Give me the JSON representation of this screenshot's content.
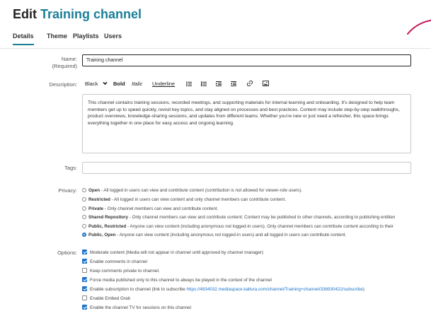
{
  "header": {
    "title_prefix": "Edit ",
    "title_name": "Training channel"
  },
  "tabs": [
    {
      "label": "Details",
      "active": true
    },
    {
      "label": "Theme",
      "active": false
    },
    {
      "label": "Playlists",
      "active": false
    },
    {
      "label": "Users",
      "active": false
    }
  ],
  "form": {
    "name_label": "Name:",
    "name_required": "(Required)",
    "name_value": "Training channel",
    "description_label": "Description:",
    "toolbar": {
      "color": "Black",
      "bold": "Bold",
      "italic": "Italic",
      "underline": "Underline",
      "icons": [
        "bullet-list-icon",
        "numbered-list-icon",
        "indent-icon",
        "outdent-icon",
        "link-icon",
        "image-icon"
      ]
    },
    "description_text": "This channel contains training sessions, recorded meetings, and supporting materials for internal learning and onboarding. It's designed to help team members get up to speed quickly, revisit key topics, and stay aligned on processes and best practices. Content may include step-by-step walkthroughs, product overviews, knowledge-sharing sessions, and updates from different teams. Whether you're new or just need a refresher, this space brings everything together in one place for easy access and ongoing learning.",
    "tags_label": "Tags:",
    "tags_value": "",
    "privacy_label": "Privacy:",
    "privacy_options": [
      {
        "name": "Open",
        "desc": " - All logged in users can view and contribute content (contribution is not allowed for viewer-role users).",
        "selected": false
      },
      {
        "name": "Restricted",
        "desc": " - All logged in users can view content and only channel members can contribute content.",
        "selected": false
      },
      {
        "name": "Private",
        "desc": " - Only channel members can view and contribute content.",
        "selected": false
      },
      {
        "name": "Shared Repository",
        "desc": " - Only channel members can view and contribute content; Content may be published to other channels, according to publishing entitlen",
        "selected": false
      },
      {
        "name": "Public, Restricted",
        "desc": " - Anyone can view content (including anonymous not logged-in users). Only channel members can contribute content according to their",
        "selected": false
      },
      {
        "name": "Public, Open",
        "desc": " - Anyone can view content (including anonymous not logged-in users) and all logged in users can contribute content.",
        "selected": true
      }
    ],
    "options_label": "Options:",
    "options": [
      {
        "text": "Moderate content (Media will not appear in channel until approved by channel manager)",
        "checked": true
      },
      {
        "text": "Enable comments in channel",
        "checked": true
      },
      {
        "text": "Keep comments private to channel.",
        "checked": false
      },
      {
        "text": "Force media published only to this channel to always be played in the context of the channel",
        "checked": true
      },
      {
        "text": "Enable subscription to channel (link to subscribe ",
        "link": "https://4834032.mediaspace.kaltura.com/channel/Training+channel/336930422/subscribe",
        "text_after": ")",
        "checked": true
      },
      {
        "text": "Enable Embed Grab",
        "checked": false
      },
      {
        "text": "Enable the channel TV for sessions on this channel",
        "checked": true
      }
    ]
  },
  "colors": {
    "accent": "#1a7f97",
    "checkbox": "#1a73c8",
    "swoosh": "#c2185b"
  }
}
